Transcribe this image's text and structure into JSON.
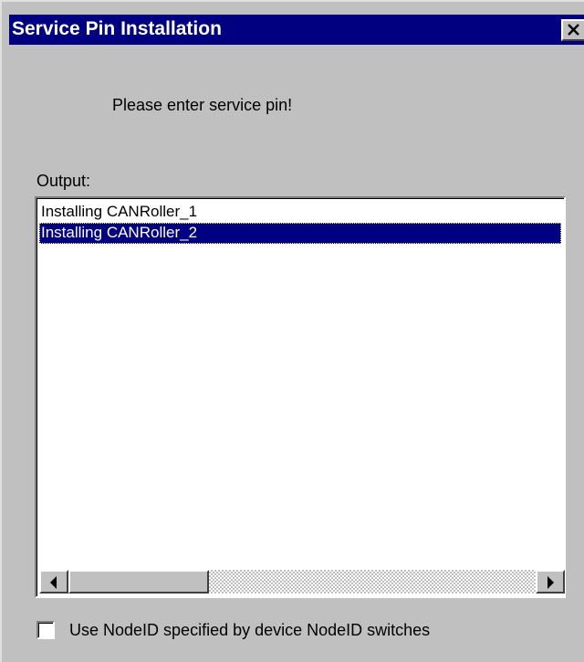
{
  "window": {
    "title": "Service Pin Installation",
    "close_icon": "close-icon"
  },
  "prompt": "Please enter service pin!",
  "output": {
    "label": "Output:",
    "items": [
      {
        "text": "Installing CANRoller_1",
        "selected": false
      },
      {
        "text": "Installing CANRoller_2",
        "selected": true
      }
    ]
  },
  "scrollbar": {
    "left_icon": "arrow-left-icon",
    "right_icon": "arrow-right-icon"
  },
  "checkbox": {
    "label": "Use NodeID specified by device NodeID switches",
    "checked": false
  },
  "colors": {
    "titlebar": "#000080",
    "face": "#c0c0c0",
    "selection": "#000080"
  }
}
